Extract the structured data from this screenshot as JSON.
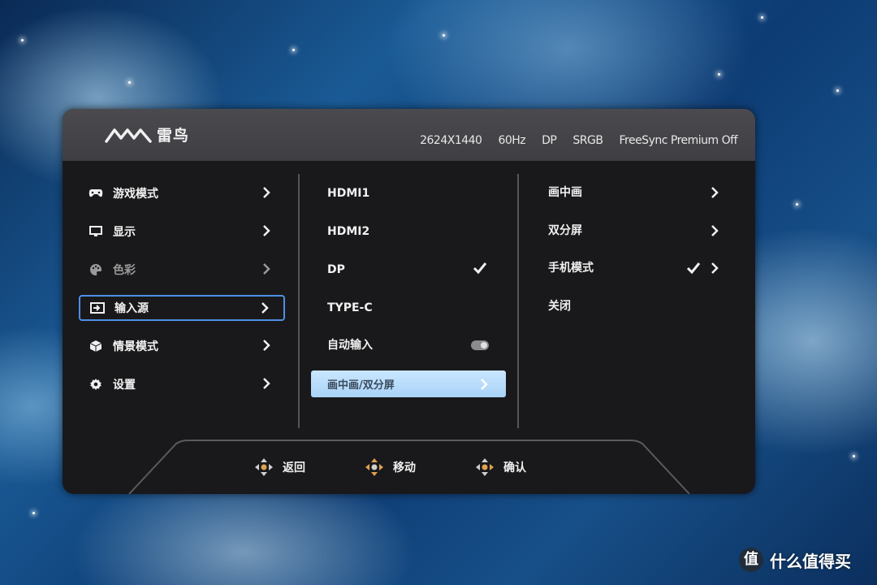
{
  "header": {
    "brand": "雷鸟",
    "resolution": "2624X1440",
    "refresh_rate": "60Hz",
    "input": "DP",
    "color_space": "SRGB",
    "freesync": "FreeSync Premium Off"
  },
  "main_menu": [
    {
      "label": "游戏模式",
      "icon": "gamepad-icon",
      "state": "normal"
    },
    {
      "label": "显示",
      "icon": "monitor-icon",
      "state": "normal"
    },
    {
      "label": "色彩",
      "icon": "palette-icon",
      "state": "disabled"
    },
    {
      "label": "输入源",
      "icon": "input-source-icon",
      "state": "selected"
    },
    {
      "label": "情景模式",
      "icon": "cube-icon",
      "state": "normal"
    },
    {
      "label": "设置",
      "icon": "gear-icon",
      "state": "normal"
    }
  ],
  "input_menu": [
    {
      "label": "HDMI1"
    },
    {
      "label": "HDMI2"
    },
    {
      "label": "DP",
      "checked": true
    },
    {
      "label": "TYPE-C"
    },
    {
      "label": "自动输入",
      "toggle": true
    },
    {
      "label": "画中画/双分屏",
      "highlighted": true
    }
  ],
  "pip_menu": [
    {
      "label": "画中画",
      "has_submenu": true
    },
    {
      "label": "双分屏",
      "has_submenu": true
    },
    {
      "label": "手机模式",
      "checked": true,
      "has_submenu": true
    },
    {
      "label": "关闭"
    }
  ],
  "footer": {
    "back": "返回",
    "move": "移动",
    "confirm": "确认"
  },
  "watermark": {
    "badge": "值",
    "text": "什么值得买"
  },
  "colors": {
    "panel": "#19191b",
    "header": "#444449",
    "selection_border": "#4e8fe6",
    "highlight": "#b8dcfb"
  }
}
